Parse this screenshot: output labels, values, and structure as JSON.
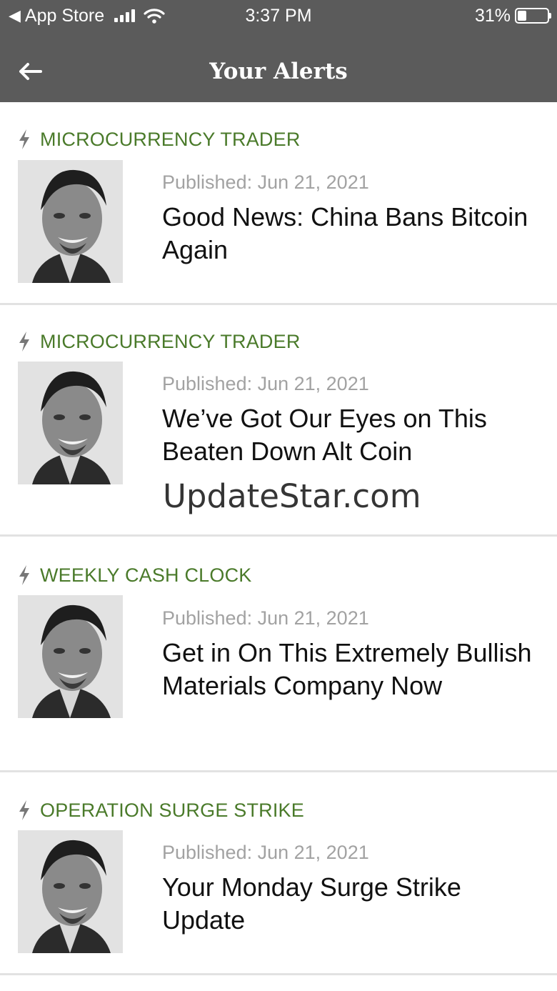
{
  "status_bar": {
    "back_app": "App Store",
    "time": "3:37 PM",
    "battery_pct": "31%",
    "battery_level": 0.31
  },
  "nav": {
    "title": "Your Alerts",
    "back_icon": "arrow-left-icon"
  },
  "alerts": [
    {
      "category": "MICROCURRENCY TRADER",
      "published": "Published: Jun 21, 2021",
      "title": "Good News: China Bans Bitcoin Again"
    },
    {
      "category": "MICROCURRENCY TRADER",
      "published": "Published: Jun 21, 2021",
      "title": "We’ve Got Our Eyes on This Beaten Down Alt Coin"
    },
    {
      "category": "WEEKLY CASH CLOCK",
      "published": "Published: Jun 21, 2021",
      "title": "Get in On This Extremely Bullish Materials Company Now"
    },
    {
      "category": "OPERATION SURGE STRIKE",
      "published": "Published: Jun 21, 2021",
      "title": "Your Monday Surge Strike Update"
    }
  ],
  "watermark": "UpdateStar.com",
  "colors": {
    "bar_bg": "#5b5b5b",
    "category_green": "#4a7a2a",
    "published_gray": "#a2a2a2",
    "divider": "#e2e2e2"
  }
}
